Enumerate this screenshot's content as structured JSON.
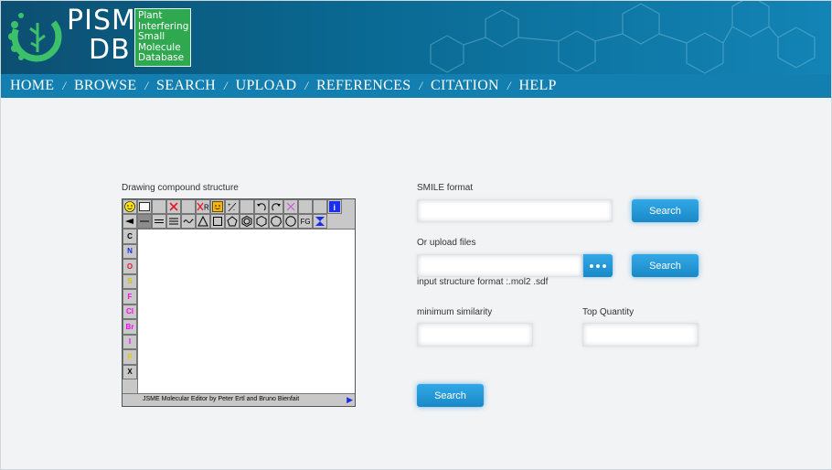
{
  "brand": {
    "logo_line1": "PISM",
    "logo_line2": "DB",
    "logo_box_lines": [
      "Plant",
      "Interfering",
      "Small",
      "Molecule",
      "Database"
    ]
  },
  "nav": {
    "items": [
      "HOME",
      "BROWSE",
      "SEARCH",
      "UPLOAD",
      "REFERENCES",
      "CITATION",
      "HELP"
    ],
    "separator": "/"
  },
  "editor": {
    "title": "Drawing compound structure",
    "atoms": [
      {
        "symbol": "C",
        "color": "#000000"
      },
      {
        "symbol": "N",
        "color": "#1a2ef0"
      },
      {
        "symbol": "O",
        "color": "#e8182c"
      },
      {
        "symbol": "S",
        "color": "#d6c400"
      },
      {
        "symbol": "F",
        "color": "#ff00ff"
      },
      {
        "symbol": "Cl",
        "color": "#ff00ff"
      },
      {
        "symbol": "Br",
        "color": "#ff00ff"
      },
      {
        "symbol": "I",
        "color": "#ff00ff"
      },
      {
        "symbol": "P",
        "color": "#e8c800"
      },
      {
        "symbol": "X",
        "color": "#000000"
      }
    ],
    "toolbar_fg_label": "FG",
    "footer_text": "JSME Molecular Editor by Peter Ertl and Bruno Bienfait"
  },
  "smile": {
    "label": "SMILE format",
    "value": "",
    "button": "Search"
  },
  "upload": {
    "label": "Or upload files",
    "value": "",
    "button": "Search",
    "format_note": "input structure format :.mol2 .sdf"
  },
  "similarity": {
    "label": "minimum similarity",
    "value": ""
  },
  "quantity": {
    "label": "Top Quantity",
    "value": ""
  },
  "main_search": {
    "button": "Search"
  },
  "colors": {
    "header_dark": "#0c4f72",
    "nav_bg": "#127fb0",
    "logo_green": "#2fa84f",
    "button_blue": "#1f95d6",
    "page_bg": "#f1f3f5"
  }
}
